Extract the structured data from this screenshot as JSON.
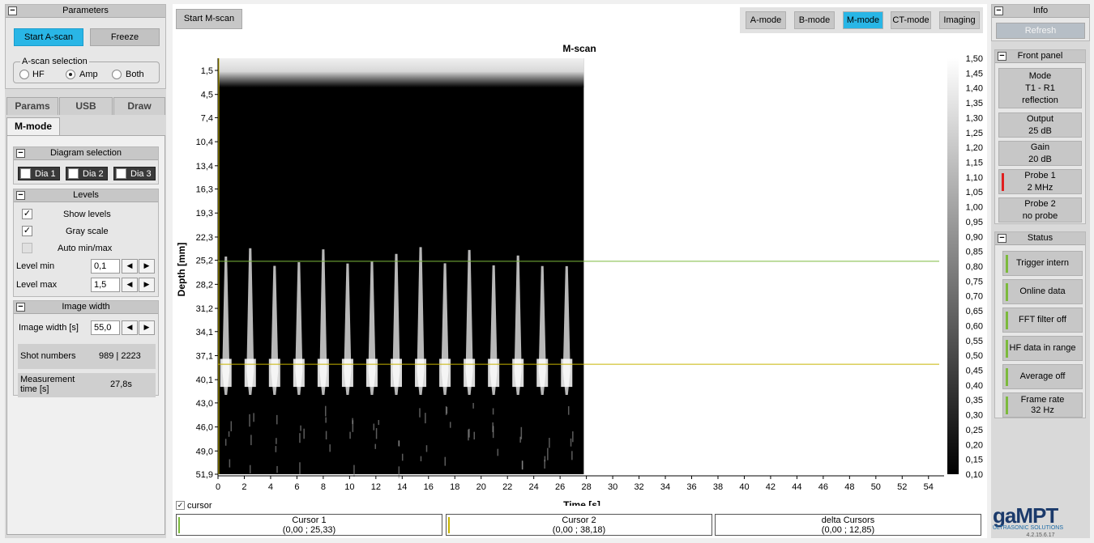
{
  "parameters": {
    "title": "Parameters",
    "start_button": "Start A-scan",
    "freeze_button": "Freeze",
    "ascan_selection_label": "A-scan selection",
    "options": [
      "HF",
      "Amp",
      "Both"
    ],
    "selected": "Amp"
  },
  "tabs": [
    "Params",
    "USB",
    "Draw",
    "M-mode"
  ],
  "active_tab": "M-mode",
  "diagram_selection": {
    "title": "Diagram selection",
    "items": [
      "Dia 1",
      "Dia 2",
      "Dia 3"
    ],
    "checked": [
      true,
      false,
      false
    ]
  },
  "levels": {
    "title": "Levels",
    "show_levels": "Show levels",
    "gray_scale": "Gray scale",
    "auto_minmax": "Auto min/max",
    "level_min_label": "Level min",
    "level_min_value": "0,1",
    "level_max_label": "Level max",
    "level_max_value": "1,5"
  },
  "image_width": {
    "title": "Image width",
    "label": "Image width [s]",
    "value": "55,0",
    "shot_numbers_label": "Shot numbers",
    "shot_numbers_value": "989 | 2223",
    "measurement_label": "Measurement time [s]",
    "measurement_value": "27,8s"
  },
  "toolbar": {
    "start_mscan": "Start M-scan",
    "modes": [
      "A-mode",
      "B-mode",
      "M-mode",
      "CT-mode",
      "Imaging"
    ],
    "active_mode": "M-mode"
  },
  "chart_data": {
    "type": "heatmap",
    "title": "M-scan",
    "xlabel": "Time [s]",
    "ylabel": "Depth [mm]",
    "xlim": [
      0,
      55
    ],
    "x_ticks": [
      0,
      2,
      4,
      6,
      8,
      10,
      12,
      14,
      16,
      18,
      20,
      22,
      24,
      26,
      28,
      30,
      32,
      34,
      36,
      38,
      40,
      42,
      44,
      46,
      48,
      50,
      52,
      54
    ],
    "y_ticks": [
      "1,5",
      "4,5",
      "7,4",
      "10,4",
      "13,4",
      "16,3",
      "19,3",
      "22,3",
      "25,2",
      "28,2",
      "31,2",
      "34,1",
      "37,1",
      "40,1",
      "43,0",
      "46,0",
      "49,0",
      "51,9"
    ],
    "colorbar_ticks": [
      "1,50",
      "1,45",
      "1,40",
      "1,35",
      "1,30",
      "1,25",
      "1,20",
      "1,15",
      "1,10",
      "1,05",
      "1,00",
      "0,95",
      "0,90",
      "0,85",
      "0,80",
      "0,75",
      "0,70",
      "0,65",
      "0,60",
      "0,55",
      "0,50",
      "0,45",
      "0,40",
      "0,35",
      "0,30",
      "0,25",
      "0,20",
      "0,15",
      "0,10"
    ],
    "data_extent_s": 27.8,
    "cursor1_depth_mm": 25.33,
    "cursor2_depth_mm": 38.18,
    "colors": {
      "cursor1": "#7cba3c",
      "cursor2": "#c8b400"
    }
  },
  "cursor_toggle": "cursor",
  "cursors": [
    {
      "title": "Cursor 1",
      "value": "(0,00 ; 25,33)"
    },
    {
      "title": "Cursor 2",
      "value": "(0,00 ; 38,18)"
    },
    {
      "title": "delta Cursors",
      "value": "(0,00 ; 12,85)"
    }
  ],
  "info": {
    "title": "Info",
    "refresh": "Refresh",
    "front_panel_title": "Front panel",
    "mode": [
      "Mode",
      "T1 - R1",
      "reflection"
    ],
    "output": [
      "Output",
      "25 dB"
    ],
    "gain": [
      "Gain",
      "20 dB"
    ],
    "probe1": [
      "Probe 1",
      "2 MHz"
    ],
    "probe2": [
      "Probe 2",
      "no probe"
    ],
    "status_title": "Status",
    "status_items": [
      "Trigger intern",
      "Online data",
      "FFT filter off",
      "HF data in range",
      "Average off",
      "Frame rate 32 Hz"
    ]
  },
  "logo": {
    "brand": "gaMPT",
    "tagline": "ULTRASONIC SOLUTIONS",
    "version": "4.2.15.6.17"
  }
}
